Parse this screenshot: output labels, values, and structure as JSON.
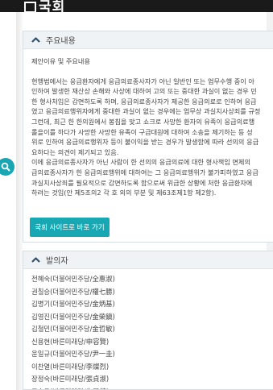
{
  "header": {
    "logo_text": "국회"
  },
  "summary": {
    "title": "주요내용",
    "intro": "제안이유 및 주요내용",
    "lines": [
      "현행법에서는 응급환자에게 응급의료종사자가 아닌 일반인 또는 업무수행 중이 아",
      "인하여 발생한 재산상 손해와 사상에 대하여 고의 또는 중대한 과실이 없는 경우 민",
      "한 형사처임은 감면하도록 하며, 응급의료종사자가 제공한 응급의료로 인하여 응급",
      "였고 응급의료행위자에게 중대한 과실이 없는 경우에는 업무상 과실치사상죄를 규정",
      "그런데, 최근 한 한의원에서 봉침을 맞고 쇼크로 사망한 환자의 유족이 응급의료행",
      "롤을이를 하다가 사망한 사망한 유족이 구급대원에 대하여 소송을 제기하는 등 성",
      "위로 인하여 응급의료행위자 등이 불이익을 받는 경우가 발생함에 따라 선의의 응급",
      "요하다는 의견이 제기되고 있음.",
      "이에 응급의료종사자가 아닌 사람이 한 선의의 응급의료에 대한 형사책임 면제의",
      "급의료종사자가 한 응급의료행위에 대하여는 그 응급의료행위가 불가피하였고 응급",
      "과실치사상죄를 필요적으로 감면하도록 함으로써 위급한 상황에 처한 응급환자에",
      "하려는 것임(안 제5조의2 각 호 외의 부분 및 제63조제1항 제2항)."
    ],
    "cta_label": "국회 사이트로 바로 가기"
  },
  "proposers": {
    "title": "발의자",
    "items": [
      "전혜숙(더불어민주당/全惠淑)",
      "권칠승(더불어민주당/權七勝)",
      "김병기(더불어민주당/金炳基)",
      "김영진(더불어민주당/金榮鎭)",
      "김철민(더불어민주당/金哲敏)",
      "신용현(바른미래당/申容賢)",
      "윤일규(더불어민주당/尹一圭)",
      "이찬열(바른미래당/李燦烈)",
      "장정숙(바른미래당/張貞淑)",
      "주승용(바른미래당/朱昇鎔)"
    ]
  },
  "colors": {
    "accent": "#18a8b3",
    "topbar": "#1a1a1a",
    "header_bg": "#f0f3f6"
  },
  "icons": {
    "collapse": "chevron-up-icon",
    "fab": "search-icon"
  }
}
